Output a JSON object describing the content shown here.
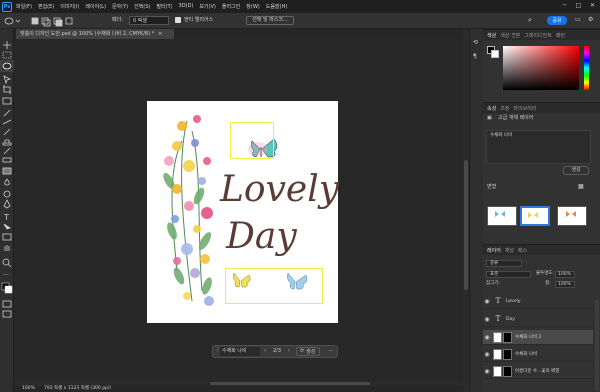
{
  "menu": {
    "app_icon": "Ps",
    "items": [
      "파일(F)",
      "편집(E)",
      "이미지(I)",
      "레이어(L)",
      "문자(Y)",
      "선택(S)",
      "필터(T)",
      "3D(D)",
      "보기(V)",
      "플러그인",
      "창(W)",
      "도움말(H)"
    ]
  },
  "options": {
    "feather_label": "페더:",
    "feather_value": "0 픽셀",
    "antialias_label": "앤티 앨리어스",
    "select_mask_label": "선택 및 마스크...",
    "share_label": "공유"
  },
  "document_tab": {
    "title": "맞춤이 디자인 도안.psd @ 100% (수채화 나비 2, CMYK/8) *",
    "close": "×"
  },
  "canvas": {
    "lovely": "Lovely",
    "day": "Day"
  },
  "context_bar": {
    "label": "수채화 나비",
    "page": "2/3",
    "generate_label": "생성"
  },
  "status": {
    "zoom": "100%",
    "doc_info": "793 픽셀 x 1123 픽셀 (300 ppi)"
  },
  "color_panel": {
    "tabs": [
      "색상",
      "색상 견본",
      "그레이디언트",
      "패턴"
    ]
  },
  "properties_panel": {
    "tabs": [
      "속성",
      "조정",
      "라이브러리"
    ],
    "type_label": "고급 개체 레이어",
    "prompt_text": "수채화 나비",
    "generate_label": "생성",
    "variants_label": "변형"
  },
  "layers_panel": {
    "tabs": [
      "레이어",
      "채널",
      "패스"
    ],
    "kind_label": "종류",
    "blend_mode": "표준",
    "opacity_label": "불투명도:",
    "opacity_value": "100%",
    "lock_label": "잠그기:",
    "fill_label": "칠:",
    "fill_value": "100%",
    "layers": [
      {
        "type": "T",
        "name": "Lovely",
        "kind": "text",
        "selected": false
      },
      {
        "type": "T",
        "name": "Day",
        "kind": "text",
        "selected": false
      },
      {
        "type": "img",
        "name": "수채화 나비 2",
        "kind": "image",
        "selected": true
      },
      {
        "type": "img",
        "name": "수채화 나비",
        "kind": "image",
        "selected": false
      },
      {
        "type": "img",
        "name": "아름다운 수...꽃의 배열",
        "kind": "image",
        "selected": false
      }
    ]
  },
  "colors": {
    "accent": "#1473e6",
    "selection_frame": "#f0ec4a",
    "title_text": "#5a3c34"
  }
}
